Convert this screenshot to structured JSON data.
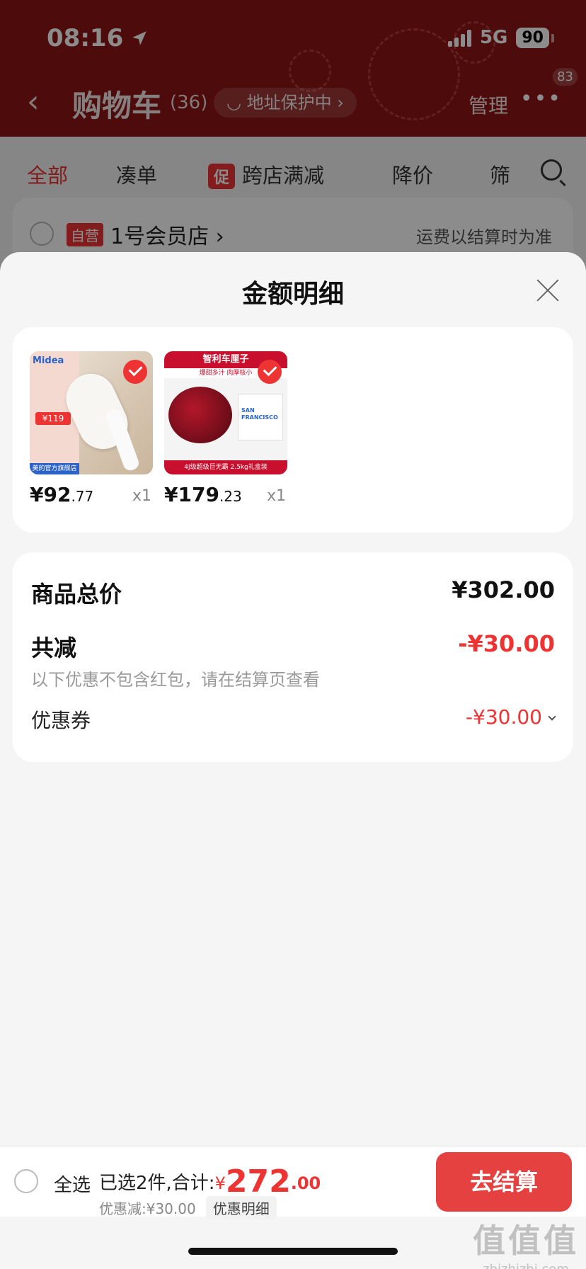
{
  "status": {
    "time": "08:16",
    "network": "5G",
    "battery": "90"
  },
  "header": {
    "title": "购物车",
    "count": "(36)",
    "address_pill": "地址保护中",
    "manage": "管理",
    "badge": "83"
  },
  "filters": {
    "all": "全部",
    "bundle": "凑单",
    "promo_tag": "促",
    "cross_store": "跨店满减",
    "price_drop": "降价",
    "filter": "筛"
  },
  "store": {
    "tag": "自营",
    "name": "1号会员店",
    "shipping": "运费以结算时为准"
  },
  "sheet": {
    "title": "金额明细",
    "products": [
      {
        "brand": "Midea",
        "price_int": "¥92",
        "price_dec": ".77",
        "qty": "x1",
        "promo_price": "¥119",
        "bottom_tag": "美的官方旗舰店"
      },
      {
        "banner": "智利车厘子",
        "sub_banner": "爆甜多汁 肉厚核小",
        "brand": "SAN FRANCISCO",
        "price_int": "¥179",
        "price_dec": ".23",
        "qty": "x1",
        "bottom_text": "4J级超级巨无霸 2.5kg礼盒装"
      }
    ],
    "total_label": "商品总价",
    "total_value": "¥302.00",
    "reduce_label": "共减",
    "reduce_value": "-¥30.00",
    "note": "以下优惠不包含红包，请在结算页查看",
    "coupon_label": "优惠券",
    "coupon_value": "-¥30.00"
  },
  "bottom": {
    "select_all": "全选",
    "selected": "已选2件,合计:",
    "currency": "¥",
    "amount_int": "272",
    "amount_dec": ".00",
    "discount": "优惠减:¥30.00",
    "discount_detail": "优惠明细",
    "checkout": "去结算"
  },
  "watermark": {
    "big": "值值值",
    "small": "zhizhizhi.com"
  },
  "colors": {
    "header_red": "#8f1414",
    "accent_red": "#e33",
    "checkout_red": "#e64141"
  }
}
